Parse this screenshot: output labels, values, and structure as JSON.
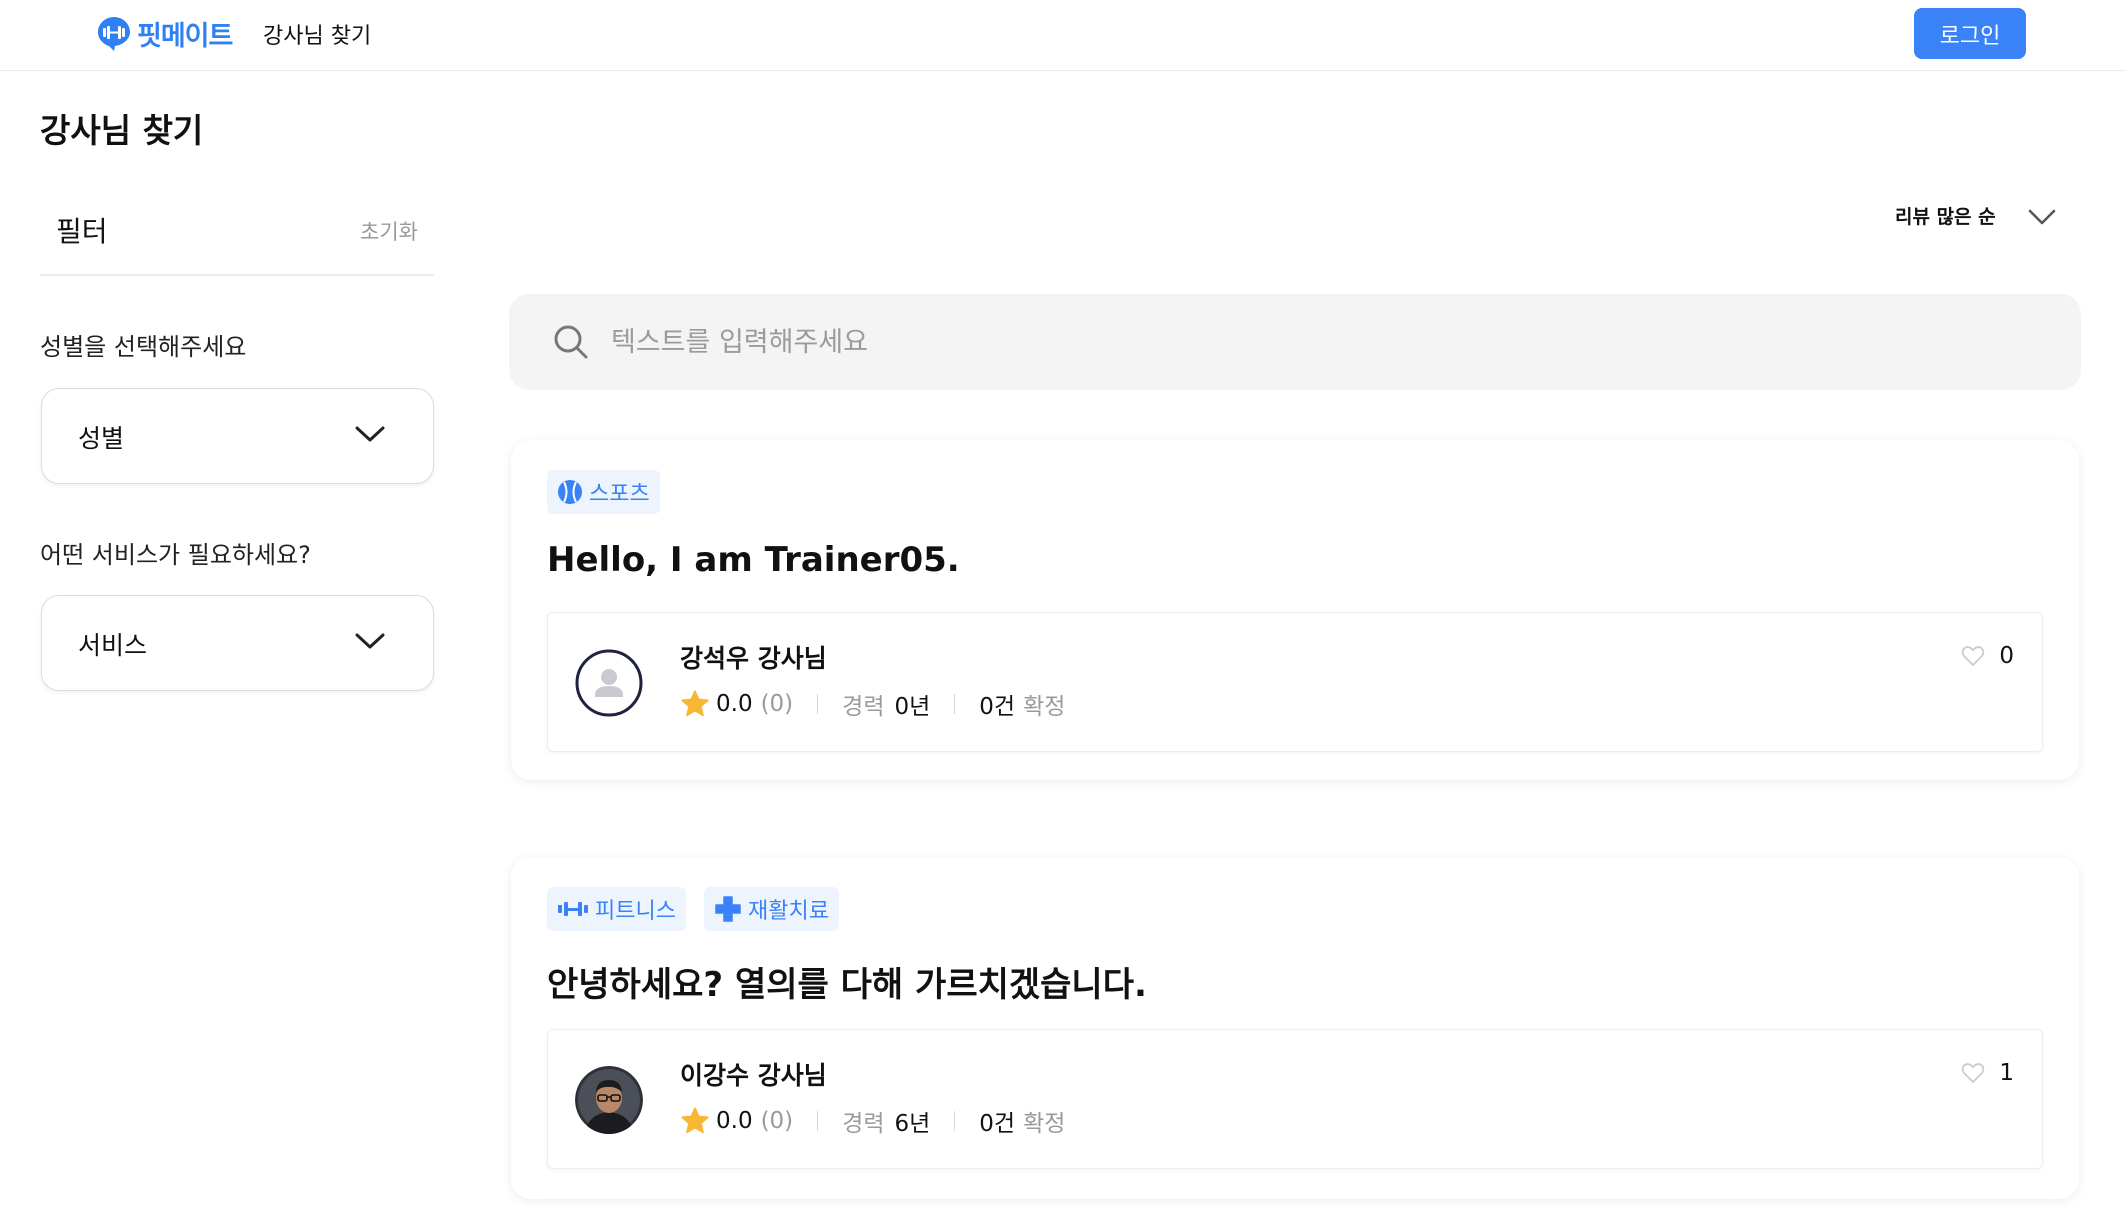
{
  "header": {
    "logo_text": "핏메이트",
    "nav_link": "강사님 찾기",
    "login_label": "로그인"
  },
  "page_title": "강사님 찾기",
  "filter": {
    "title": "필터",
    "reset_label": "초기화",
    "gender": {
      "question": "성별을 선택해주세요",
      "value": "성별"
    },
    "service": {
      "question": "어떤 서비스가 필요하세요?",
      "value": "서비스"
    }
  },
  "sort": {
    "label": "리뷰 많은 순"
  },
  "search": {
    "placeholder": "텍스트를 입력해주세요"
  },
  "colors": {
    "accent": "#3a82f7",
    "star": "#f7b733"
  },
  "cards": [
    {
      "tags": [
        {
          "icon": "sports-ball-icon",
          "label": "스포츠"
        }
      ],
      "title": "Hello, I am Trainer05.",
      "trainer": {
        "name": "강석우 강사님",
        "rating": "0.0",
        "review_count": "(0)",
        "experience_label": "경력",
        "experience_value": "0년",
        "confirmed_count": "0건",
        "confirmed_label": "확정",
        "likes": "0",
        "avatar": "default-avatar"
      }
    },
    {
      "tags": [
        {
          "icon": "dumbbell-icon",
          "label": "피트니스"
        },
        {
          "icon": "medical-cross-icon",
          "label": "재활치료"
        }
      ],
      "title": "안녕하세요? 열의를 다해 가르치겠습니다.",
      "trainer": {
        "name": "이강수 강사님",
        "rating": "0.0",
        "review_count": "(0)",
        "experience_label": "경력",
        "experience_value": "6년",
        "confirmed_count": "0건",
        "confirmed_label": "확정",
        "likes": "1",
        "avatar": "photo-avatar"
      }
    }
  ]
}
